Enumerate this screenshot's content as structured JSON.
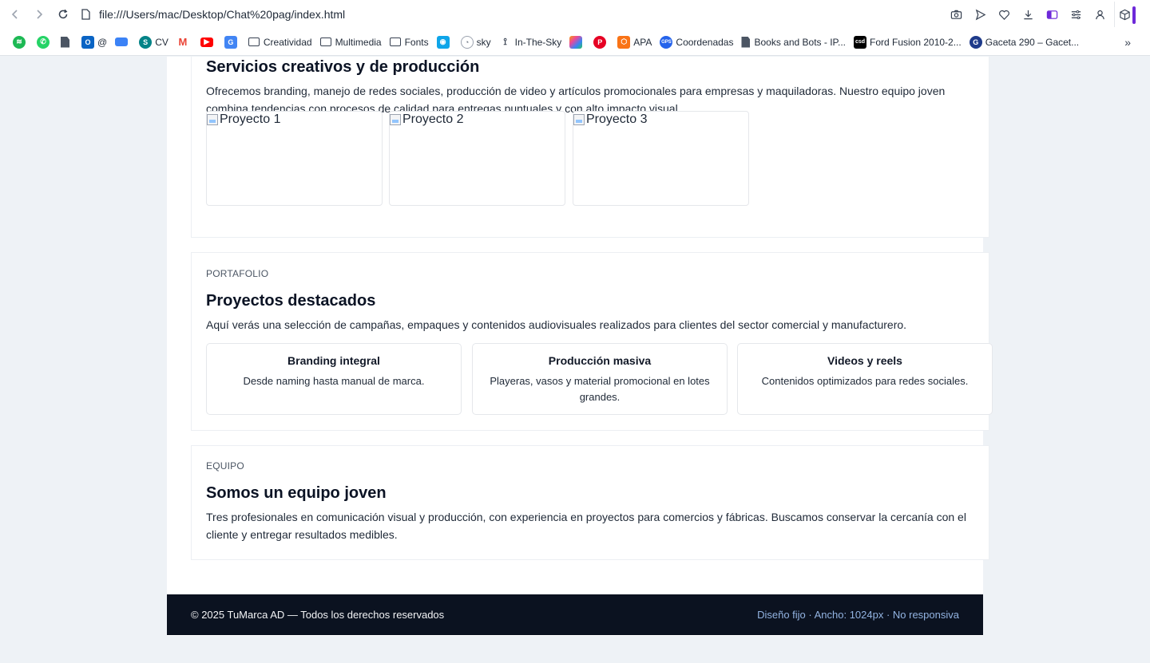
{
  "browser": {
    "url": "file:///Users/mac/Desktop/Chat%20pag/index.html",
    "toolbar_icons": [
      "camera-icon",
      "send-icon",
      "heart-icon",
      "download-icon",
      "sidebar-toggle-icon",
      "settings-sliders-icon",
      "profile-icon",
      "extensions-cube-icon"
    ],
    "accent_color": "#6d28d9",
    "bookmarks": [
      {
        "label": "",
        "icon": "spotify-icon",
        "color": "#1db954"
      },
      {
        "label": "",
        "icon": "whatsapp-icon",
        "color": "#25d366"
      },
      {
        "label": "",
        "icon": "document-icon",
        "color": "#4b5563"
      },
      {
        "label": "@",
        "icon": "outlook-icon",
        "color": "#0a64c4"
      },
      {
        "label": "",
        "icon": "folder-blue-icon",
        "color": "#3b82f6"
      },
      {
        "label": "CV",
        "icon": "sharepoint-icon",
        "color": "#038387"
      },
      {
        "label": "",
        "icon": "gmail-icon",
        "color": "#ea4335"
      },
      {
        "label": "",
        "icon": "youtube-icon",
        "color": "#ff0000"
      },
      {
        "label": "",
        "icon": "translate-icon",
        "color": "#4285f4"
      },
      {
        "label": "Creatividad",
        "icon": "folder-icon"
      },
      {
        "label": "Multimedia",
        "icon": "folder-icon"
      },
      {
        "label": "Fonts",
        "icon": "folder-icon"
      },
      {
        "label": "",
        "icon": "location-pin-icon",
        "color": "#0ea5e9"
      },
      {
        "label": "sky",
        "icon": "speedometer-icon",
        "color": "#6b7280"
      },
      {
        "label": "In-The-Sky",
        "icon": "telescope-icon",
        "color": "#374151"
      },
      {
        "label": "",
        "icon": "photos-icon",
        "color": "#f59e0b"
      },
      {
        "label": "",
        "icon": "pinterest-icon",
        "color": "#e60023"
      },
      {
        "label": "APA",
        "icon": "apa-icon",
        "color": "#f97316"
      },
      {
        "label": "Coordenadas",
        "icon": "gps-icon",
        "color": "#2563eb"
      },
      {
        "label": "Books and Bots - IP...",
        "icon": "document-icon"
      },
      {
        "label": "Ford Fusion 2010-2...",
        "icon": "csd-icon",
        "color": "#000000"
      },
      {
        "label": "Gaceta 290 – Gacet...",
        "icon": "gaceta-icon",
        "color": "#1e3a8a"
      }
    ]
  },
  "services": {
    "title": "Servicios creativos y de producción",
    "description": "Ofrecemos branding, manejo de redes sociales, producción de video y artículos promocionales para empresas y maquiladoras. Nuestro equipo joven combina tendencias con procesos de calidad para entregas puntuales y con alto impacto visual.",
    "images": [
      {
        "alt": "Proyecto 1"
      },
      {
        "alt": "Proyecto 2"
      },
      {
        "alt": "Proyecto 3"
      }
    ]
  },
  "portfolio": {
    "eyebrow": "PORTAFOLIO",
    "title": "Proyectos destacados",
    "description": "Aquí verás una selección de campañas, empaques y contenidos audiovisuales realizados para clientes del sector comercial y manufacturero.",
    "items": [
      {
        "title": "Branding integral",
        "desc": "Desde naming hasta manual de marca."
      },
      {
        "title": "Producción masiva",
        "desc": "Playeras, vasos y material promocional en lotes grandes."
      },
      {
        "title": "Videos y reels",
        "desc": "Contenidos optimizados para redes sociales."
      }
    ]
  },
  "team": {
    "eyebrow": "EQUIPO",
    "title": "Somos un equipo joven",
    "description": "Tres profesionales en comunicación visual y producción, con experiencia en proyectos para comercios y fábricas. Buscamos conservar la cercanía con el cliente y entregar resultados medibles."
  },
  "footer": {
    "copyright": "© 2025 TuMarca AD — Todos los derechos reservados",
    "note": "Diseño fijo · Ancho: 1024px · No responsiva",
    "background": "#0b1220"
  }
}
